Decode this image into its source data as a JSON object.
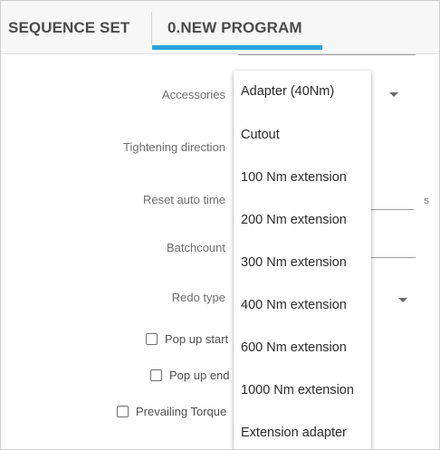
{
  "tabs": [
    {
      "label": "SEQUENCE SET"
    },
    {
      "label": "0.NEW PROGRAM"
    }
  ],
  "form": {
    "accessories_label": "Accessories",
    "tightening_direction_label": "Tightening direction",
    "reset_auto_time_label": "Reset auto time",
    "reset_auto_time_unit": "s",
    "batchcount_label": "Batchcount",
    "redo_type_label": "Redo type",
    "popup_start_label": "Pop up start",
    "popup_end_label": "Pop up end",
    "prevailing_torque_label": "Prevailing Torque"
  },
  "dropdown": {
    "options": [
      "Adapter (40Nm)",
      "Cutout",
      "100 Nm extension",
      "200 Nm extension",
      "300 Nm extension",
      "400 Nm extension",
      "600 Nm extension",
      "1000 Nm extension",
      "Extension adapter"
    ]
  },
  "accent_color": "#2aa3dd"
}
